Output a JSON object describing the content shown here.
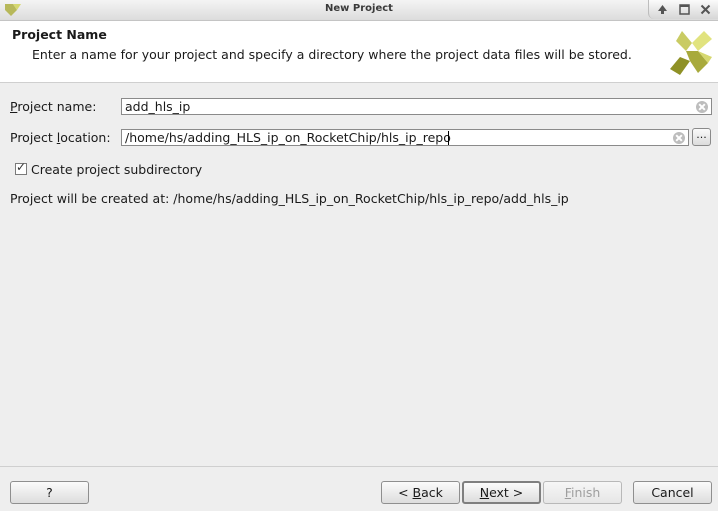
{
  "window": {
    "title": "New Project"
  },
  "header": {
    "title": "Project Name",
    "description": "Enter a name for your project and specify a directory where the project data files will be stored."
  },
  "form": {
    "name_label_mnemonic": "P",
    "name_label_rest": "roject name:",
    "name_value": "add_hls_ip",
    "location_label_pre": "Project ",
    "location_label_mnemonic": "l",
    "location_label_rest": "ocation:",
    "location_value": "/home/hs/adding_HLS_ip_on_RocketChip/hls_ip_repo",
    "browse_label": "...",
    "subdir_label": "Create project subdirectory",
    "subdir_checked": true,
    "created_at_text": "Project will be created at: /home/hs/adding_HLS_ip_on_RocketChip/hls_ip_repo/add_hls_ip"
  },
  "footer": {
    "help_label": "?",
    "back_pre": "< ",
    "back_mnemonic": "B",
    "back_rest": "ack",
    "next_mnemonic": "N",
    "next_rest": "ext >",
    "finish_mnemonic": "F",
    "finish_rest": "inish",
    "cancel_label": "Cancel"
  },
  "icons": {
    "app": "vivado-logo-icon",
    "header": "vivado-logo-icon",
    "minimize": "minimize-icon",
    "maximize": "maximize-icon",
    "close": "close-icon"
  },
  "colors": {
    "logo_dark": "#9a9a2a",
    "logo_light": "#d6d870"
  }
}
